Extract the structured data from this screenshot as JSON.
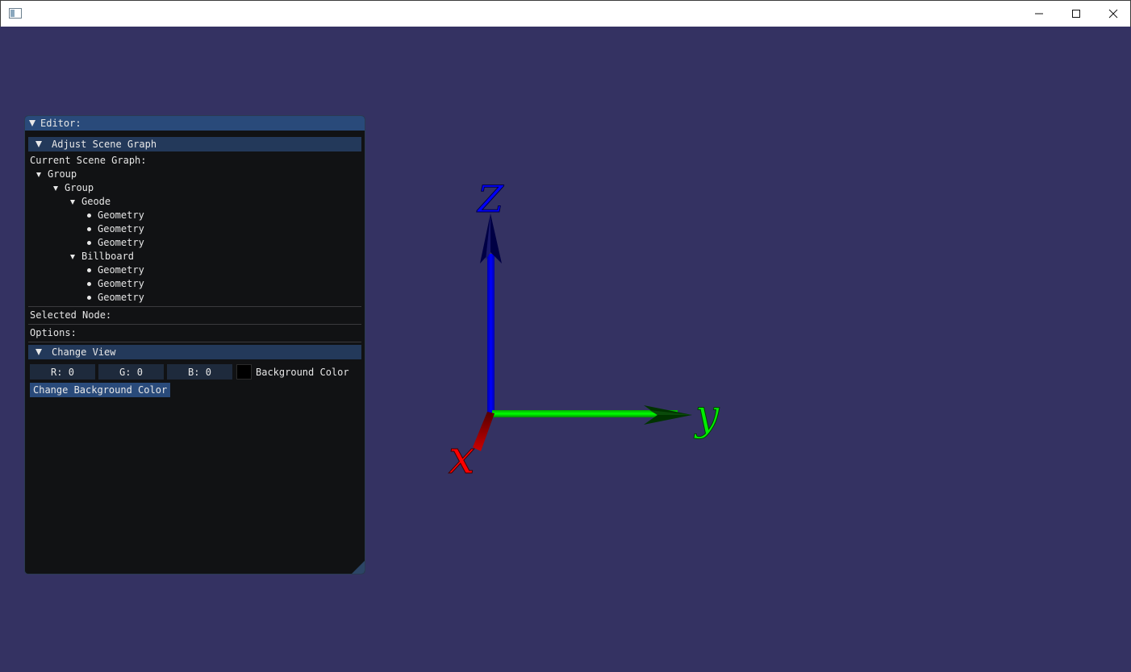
{
  "window": {
    "title": "",
    "controls": {
      "minimize": "minimize-icon",
      "maximize": "maximize-icon",
      "close": "close-icon"
    }
  },
  "colors": {
    "background": "#343262",
    "panel": "#111214",
    "title_active": "#294a7a",
    "header": "#23395a",
    "z_axis": "#0000ff",
    "y_axis": "#00dd00",
    "x_axis": "#ff0000"
  },
  "editor": {
    "title": "Editor:",
    "scene_section": {
      "header": "Adjust Scene Graph",
      "current_label": "Current Scene Graph:",
      "tree": {
        "root": "Group",
        "child_group": "Group",
        "geode": "Geode",
        "geode_items": [
          "Geometry",
          "Geometry",
          "Geometry"
        ],
        "billboard": "Billboard",
        "billboard_items": [
          "Geometry",
          "Geometry",
          "Geometry"
        ]
      },
      "selected_label": "Selected Node:",
      "options_label": "Options:"
    },
    "view_section": {
      "header": "Change View",
      "r": "R:  0",
      "g": "G:  0",
      "b": "B:  0",
      "bg_label": "Background Color",
      "button": "Change Background Color"
    }
  },
  "axes": {
    "z_label": "Z",
    "y_label": "y",
    "x_label": "x"
  }
}
